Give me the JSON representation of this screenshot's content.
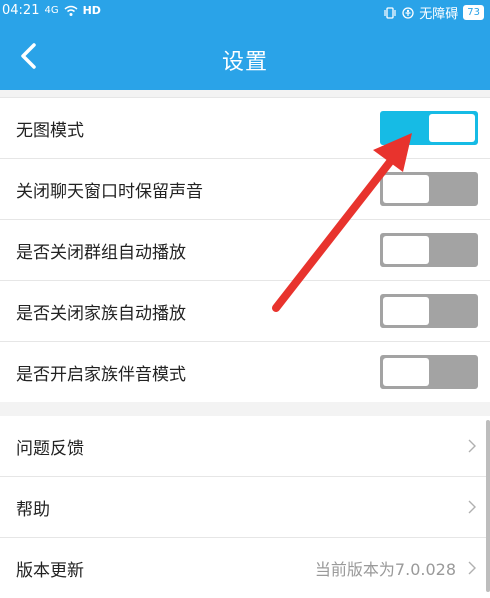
{
  "statusbar": {
    "time": "04:21",
    "signal": "4G",
    "network": "HD",
    "accessibility": "无障碍",
    "battery": "73"
  },
  "navbar": {
    "title": "设置"
  },
  "settings": {
    "toggles": [
      {
        "label": "无图模式",
        "state": "on"
      },
      {
        "label": "关闭聊天窗口时保留声音",
        "state": "off"
      },
      {
        "label": "是否关闭群组自动播放",
        "state": "off"
      },
      {
        "label": "是否关闭家族自动播放",
        "state": "off"
      },
      {
        "label": "是否开启家族伴音模式",
        "state": "off"
      }
    ],
    "links": [
      {
        "label": "问题反馈"
      },
      {
        "label": "帮助"
      },
      {
        "label": "版本更新",
        "value": "当前版本为7.0.028"
      }
    ]
  },
  "colors": {
    "header": "#2aa3e8",
    "toggle_on": "#16bbe5",
    "toggle_off": "#a3a3a3",
    "annotation_arrow": "#e8332d"
  },
  "icons": {
    "back": "chevron-left-icon",
    "row_arrow": "chevron-right-icon"
  }
}
